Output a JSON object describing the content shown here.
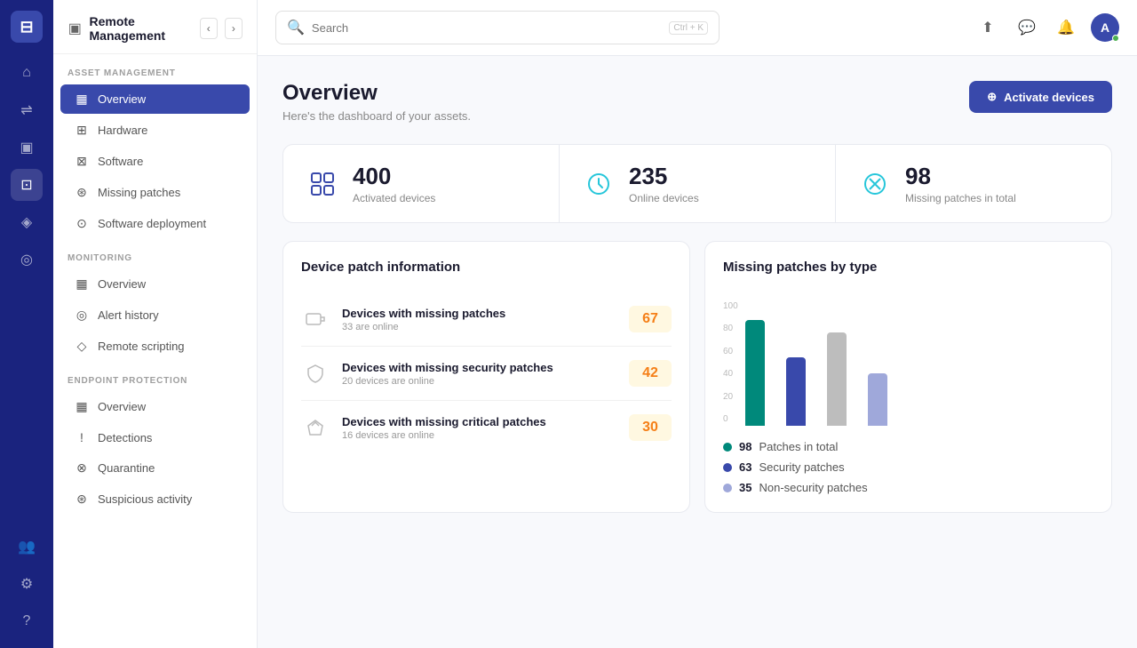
{
  "app": {
    "logo": "⊟",
    "title": "Remote Management"
  },
  "topbar": {
    "search_placeholder": "Search",
    "search_shortcut": "Ctrl + K",
    "back_nav": "‹",
    "forward_nav": "›"
  },
  "sidebar": {
    "asset_management_label": "ASSET MANAGEMENT",
    "asset_items": [
      {
        "id": "overview",
        "label": "Overview",
        "icon": "▦",
        "active": true
      },
      {
        "id": "hardware",
        "label": "Hardware",
        "icon": "⊞"
      },
      {
        "id": "software",
        "label": "Software",
        "icon": "⊠"
      },
      {
        "id": "missing-patches",
        "label": "Missing patches",
        "icon": "⊛"
      },
      {
        "id": "software-deployment",
        "label": "Software deployment",
        "icon": "⊙"
      }
    ],
    "monitoring_label": "MONITORING",
    "monitoring_items": [
      {
        "id": "mon-overview",
        "label": "Overview",
        "icon": "▦"
      },
      {
        "id": "alert-history",
        "label": "Alert history",
        "icon": "◎"
      },
      {
        "id": "remote-scripting",
        "label": "Remote scripting",
        "icon": "◇"
      }
    ],
    "endpoint_label": "ENDPOINT PROTECTION",
    "endpoint_items": [
      {
        "id": "ep-overview",
        "label": "Overview",
        "icon": "▦"
      },
      {
        "id": "detections",
        "label": "Detections",
        "icon": "!"
      },
      {
        "id": "quarantine",
        "label": "Quarantine",
        "icon": "⊗"
      },
      {
        "id": "suspicious",
        "label": "Suspicious activity",
        "icon": "⊛"
      }
    ]
  },
  "page": {
    "title": "Overview",
    "subtitle": "Here's the dashboard of your assets.",
    "activate_btn": "Activate devices"
  },
  "stats": [
    {
      "id": "activated",
      "number": "400",
      "label": "Activated devices",
      "icon_color": "#3949ab"
    },
    {
      "id": "online",
      "number": "235",
      "label": "Online devices",
      "icon_color": "#26c6da"
    },
    {
      "id": "missing-patches",
      "number": "98",
      "label": "Missing patches in total",
      "icon_color": "#26c6da"
    }
  ],
  "patch_panel": {
    "title": "Device patch information",
    "items": [
      {
        "id": "missing-patches",
        "title": "Devices with missing patches",
        "sub": "33 are online",
        "count": "67"
      },
      {
        "id": "missing-security",
        "title": "Devices with missing security patches",
        "sub": "20 devices are online",
        "count": "42"
      },
      {
        "id": "missing-critical",
        "title": "Devices with missing critical patches",
        "sub": "16 devices are online",
        "count": "30"
      }
    ]
  },
  "chart_panel": {
    "title": "Missing patches by type",
    "y_labels": [
      "0",
      "20",
      "40",
      "60",
      "80",
      "100"
    ],
    "bars": [
      {
        "id": "total",
        "color": "#00897b",
        "height_pct": 85
      },
      {
        "id": "security",
        "color": "#3949ab",
        "height_pct": 55
      },
      {
        "id": "nonsecurity1",
        "color": "#bdbdbd",
        "height_pct": 75
      },
      {
        "id": "nonsecurity2",
        "color": "#9fa8da",
        "height_pct": 42
      }
    ],
    "legend": [
      {
        "id": "total",
        "color": "#00897b",
        "count": "98",
        "label": "Patches in total"
      },
      {
        "id": "security",
        "color": "#3949ab",
        "count": "63",
        "label": "Security patches"
      },
      {
        "id": "nonsecurity",
        "color": "#9fa8da",
        "count": "35",
        "label": "Non-security patches"
      }
    ]
  },
  "icons": {
    "logo": "⊟",
    "home": "⌂",
    "filter": "⇌",
    "monitor": "▣",
    "patch": "⊡",
    "diamond": "◈",
    "shield": "◎",
    "gear": "⚙",
    "help": "?",
    "users": "👥",
    "upload": "⬆",
    "chat": "💬",
    "bell": "🔔",
    "search": "🔍",
    "plus": "+"
  }
}
